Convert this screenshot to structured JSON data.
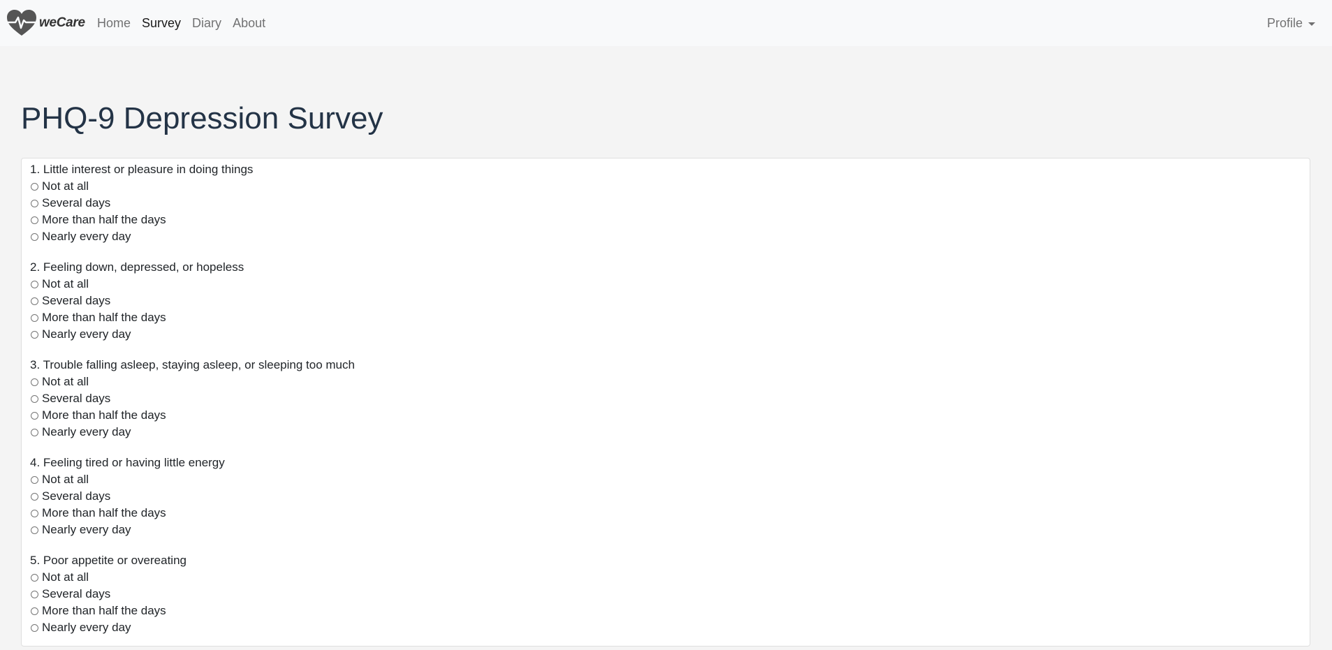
{
  "brand": {
    "name": "weCare",
    "icon": "heart-pulse-icon"
  },
  "nav": {
    "items": [
      {
        "label": "Home",
        "active": false
      },
      {
        "label": "Survey",
        "active": true
      },
      {
        "label": "Diary",
        "active": false
      },
      {
        "label": "About",
        "active": false
      }
    ],
    "profile_label": "Profile"
  },
  "page": {
    "title": "PHQ-9 Depression Survey"
  },
  "survey": {
    "options": [
      "Not at all",
      "Several days",
      "More than half the days",
      "Nearly every day"
    ],
    "questions": [
      {
        "text": "1. Little interest or pleasure in doing things"
      },
      {
        "text": "2. Feeling down, depressed, or hopeless"
      },
      {
        "text": "3. Trouble falling asleep, staying asleep, or sleeping too much"
      },
      {
        "text": "4. Feeling tired or having little energy"
      },
      {
        "text": "5. Poor appetite or overeating"
      }
    ]
  },
  "colors": {
    "title": "#233346",
    "navbar_bg": "#f8f9fa",
    "page_bg": "#f4f4f4",
    "brand_icon": "#555555"
  }
}
